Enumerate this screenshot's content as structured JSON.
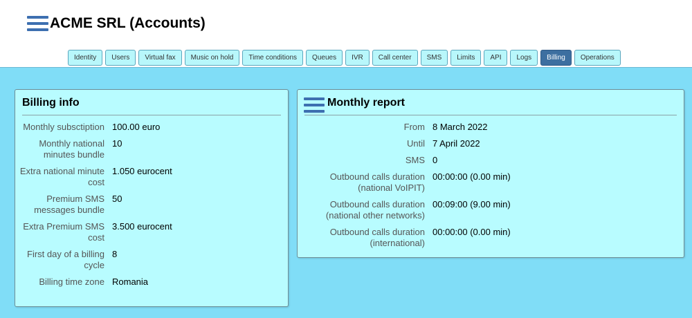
{
  "header": {
    "title": "ACME SRL (Accounts)",
    "menu_icon": "hamburger-menu-icon"
  },
  "tabs": [
    {
      "label": "Identity"
    },
    {
      "label": "Users"
    },
    {
      "label": "Virtual fax"
    },
    {
      "label": "Music on hold"
    },
    {
      "label": "Time conditions"
    },
    {
      "label": "Queues"
    },
    {
      "label": "IVR"
    },
    {
      "label": "Call center"
    },
    {
      "label": "SMS"
    },
    {
      "label": "Limits"
    },
    {
      "label": "API"
    },
    {
      "label": "Logs"
    },
    {
      "label": "Billing",
      "active": true
    },
    {
      "label": "Operations"
    }
  ],
  "billing_info": {
    "title": "Billing info",
    "rows": [
      {
        "label": "Monthly subsctiption",
        "value": "100.00 euro"
      },
      {
        "label": "Monthly national minutes bundle",
        "value": "10"
      },
      {
        "label": "Extra national minute cost",
        "value": "1.050 eurocent"
      },
      {
        "label": "Premium SMS messages bundle",
        "value": "50"
      },
      {
        "label": "Extra Premium SMS cost",
        "value": "3.500 eurocent"
      },
      {
        "label": "First day of a billing cycle",
        "value": "8"
      },
      {
        "label": "Billing time zone",
        "value": "Romania"
      }
    ]
  },
  "monthly_report": {
    "title": "Monthly report",
    "menu_icon": "hamburger-menu-icon",
    "rows": [
      {
        "label": "From",
        "value": "8 March 2022"
      },
      {
        "label": "Until",
        "value": "7 April 2022"
      },
      {
        "label": "SMS",
        "value": "0"
      },
      {
        "label": "Outbound calls duration (national VoIPIT)",
        "value": "00:00:00 (0.00 min)"
      },
      {
        "label": "Outbound calls duration (national other networks)",
        "value": "00:09:00 (9.00 min)"
      },
      {
        "label": "Outbound calls duration (international)",
        "value": "00:00:00 (0.00 min)"
      }
    ]
  },
  "colors": {
    "content_bg": "#80ddf7",
    "panel_bg": "#b8fcff",
    "tab_bg": "#b8f7fb",
    "tab_active_bg": "#3d6fa0",
    "menu_icon": "#3d6fb0"
  }
}
